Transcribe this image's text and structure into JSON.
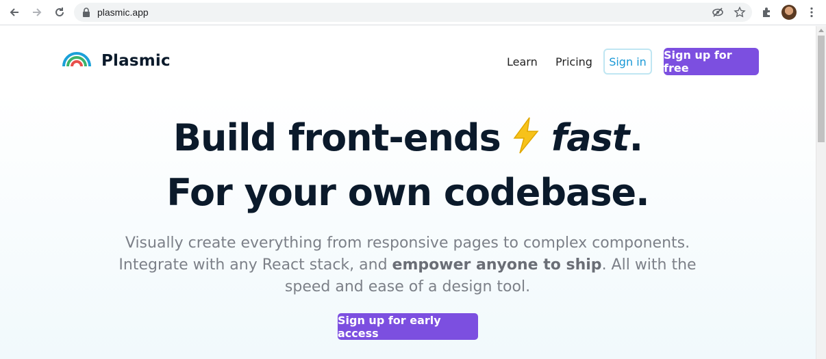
{
  "browser": {
    "url": "plasmic.app"
  },
  "header": {
    "brand": "Plasmic",
    "nav": {
      "learn": "Learn",
      "pricing": "Pricing",
      "sign_in": "Sign in",
      "sign_up": "Sign up for free"
    }
  },
  "hero": {
    "line1_a": "Build front-ends",
    "line1_b": "fast",
    "line1_c": ".",
    "line2": "For your own codebase.",
    "sub_a": "Visually create everything from responsive pages to complex components. Integrate with any React stack, and ",
    "sub_bold": "empower anyone to ship",
    "sub_b": ". All with the speed and ease of a design tool.",
    "cta": "Sign up for early access"
  },
  "colors": {
    "accent": "#7c4fe0",
    "headline": "#0b1a2b",
    "signin_text": "#1898d6"
  }
}
